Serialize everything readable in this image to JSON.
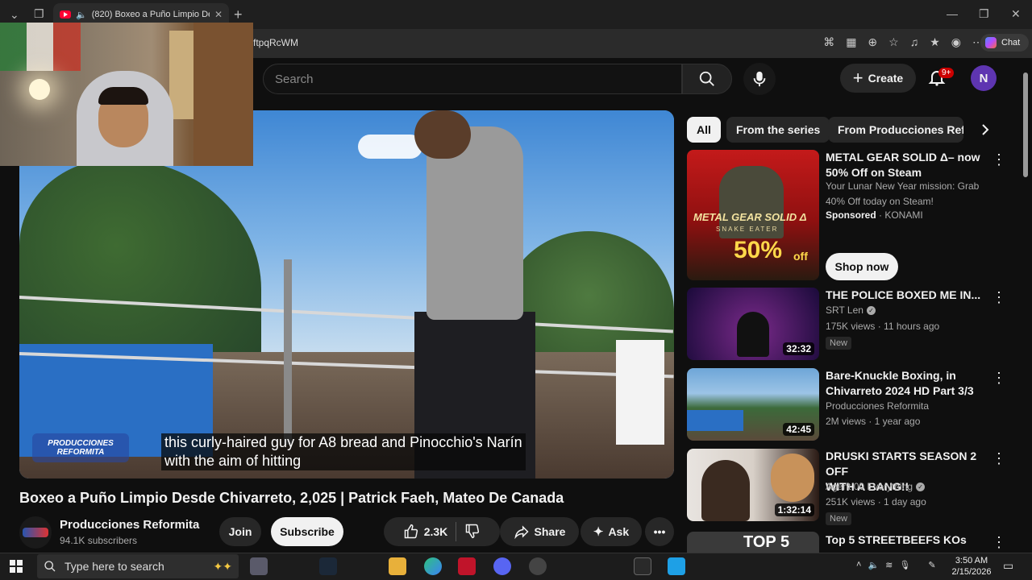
{
  "browser": {
    "tab_title": "(820) Boxeo a Puño Limpio De",
    "url_fragment": "ftpqRcWM",
    "chat_label": "Chat"
  },
  "masthead": {
    "search_placeholder": "Search",
    "create_label": "Create",
    "notification_count": "9+",
    "account_initial": "N"
  },
  "video": {
    "subtitle_line1": "this curly-haired guy for A8 bread and Pinocchio's Narín",
    "subtitle_line2": "with the aim of hitting",
    "watermark_line1": "PRODUCCIONES",
    "watermark_line2": "REFORMITA",
    "title": "Boxeo a Puño Limpio Desde Chivarreto, 2,025 | Patrick Faeh, Mateo De Canada"
  },
  "channel": {
    "name": "Producciones  Reformita",
    "subscribers": "94.1K subscribers",
    "join_label": "Join",
    "subscribe_label": "Subscribe"
  },
  "actions": {
    "likes": "2.3K",
    "share_label": "Share",
    "ask_label": "Ask"
  },
  "chips": {
    "all": "All",
    "from_series": "From the series",
    "from_producciones": "From Producciones Refor"
  },
  "ad": {
    "title_line1": "METAL GEAR SOLID Δ– now",
    "title_line2": "50% Off on Steam",
    "desc_line1": "Your Lunar New Year mission: Grab",
    "desc_line2": "40% Off today on Steam!",
    "sponsored": "Sponsored",
    "advertiser": "· KONAMI",
    "cta": "Shop now",
    "thumb_text": "METAL GEAR SOLID Δ",
    "thumb_sub": "SNAKE EATER",
    "thumb_discount": "50%",
    "thumb_off": "off"
  },
  "recommendations": [
    {
      "title": "THE POLICE BOXED ME IN...",
      "channel": "SRT Len",
      "meta": "175K views · 11 hours ago",
      "badge": "New",
      "duration": "32:32"
    },
    {
      "title_line1": "Bare-Knuckle Boxing, in",
      "title_line2": "Chivarreto 2024 HD Part 3/3",
      "channel": "Producciones Reformita",
      "meta": "2M views · 1 year ago",
      "duration": "42:45"
    },
    {
      "title_line1": "DRUSKI STARTS SEASON 2 OFF",
      "title_line2": "WITH A BANG!!",
      "channel": "Agent 00 Everything",
      "meta": "251K views · 1 day ago",
      "badge": "New",
      "duration": "1:32:14"
    },
    {
      "title": "Top 5 STREETBEEFS KOs",
      "thumb_text": "TOP 5"
    }
  ],
  "taskbar": {
    "search_placeholder": "Type here to search",
    "time": "3:50 AM",
    "date": "2/15/2026"
  }
}
